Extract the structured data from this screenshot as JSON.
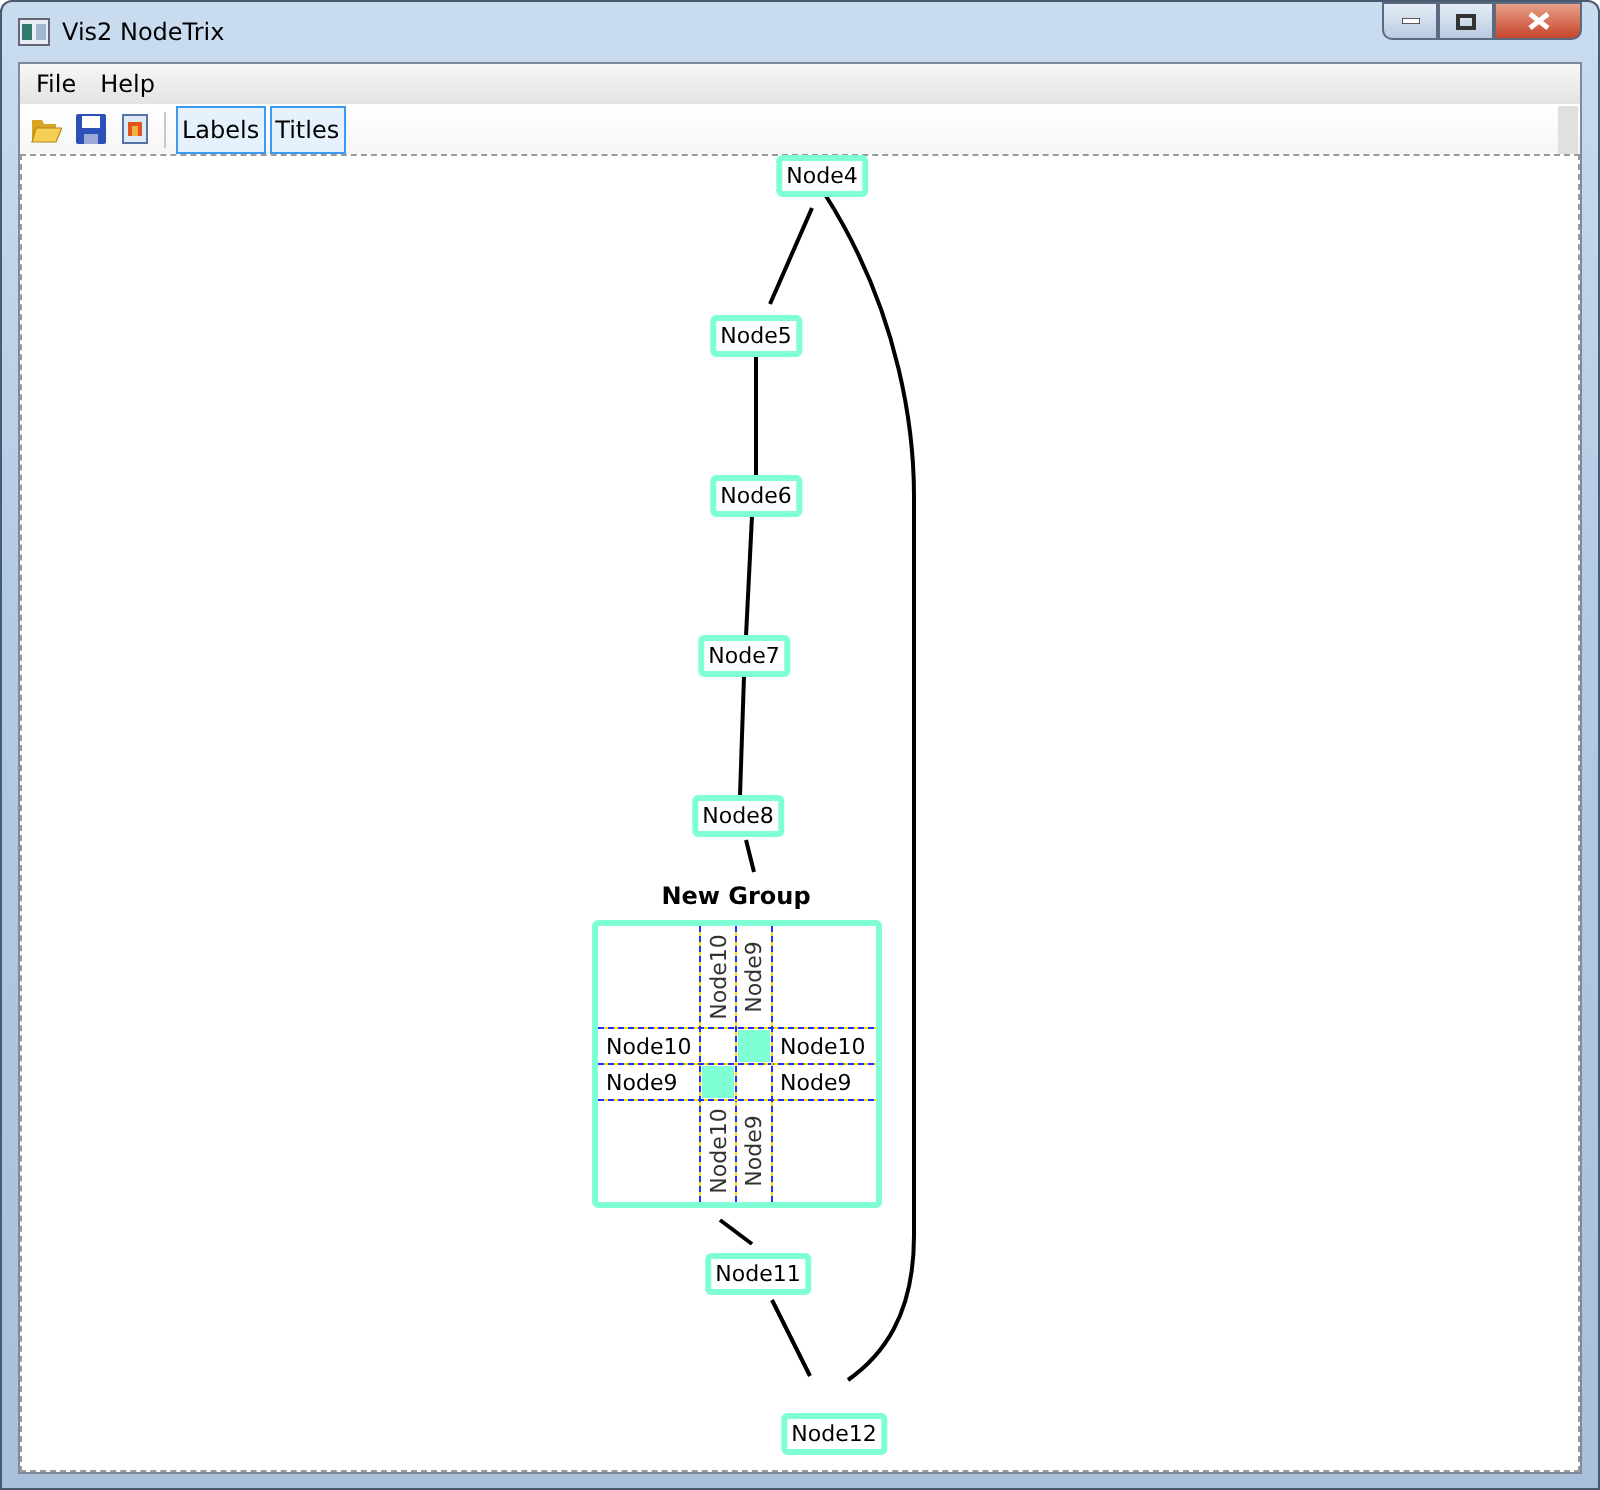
{
  "window": {
    "title": "Vis2 NodeTrix"
  },
  "menu": [
    "File",
    "Help"
  ],
  "toolbar": {
    "icon_buttons": [
      {
        "kind": "open"
      },
      {
        "kind": "save"
      },
      {
        "kind": "export"
      }
    ],
    "toggle_buttons": [
      "Labels",
      "Titles"
    ]
  },
  "nodes": [
    {
      "label": "Node4"
    },
    {
      "label": "Node5"
    },
    {
      "label": "Node6"
    },
    {
      "label": "Node7"
    },
    {
      "label": "Node8"
    },
    {
      "label": "Node11"
    },
    {
      "label": "Node12"
    }
  ],
  "group": {
    "title": "New Group",
    "column_labels_top": [
      "Node10",
      "Node9"
    ],
    "row_labels_left": [
      "Node10",
      "Node9"
    ],
    "row_labels_right": [
      "Node10",
      "Node9"
    ],
    "column_labels_bottom": [
      "Node10",
      "Node9"
    ],
    "cells": [
      [
        {
          "filled": false
        },
        {
          "filled": true
        }
      ],
      [
        {
          "filled": true
        },
        {
          "filled": false
        }
      ]
    ]
  }
}
